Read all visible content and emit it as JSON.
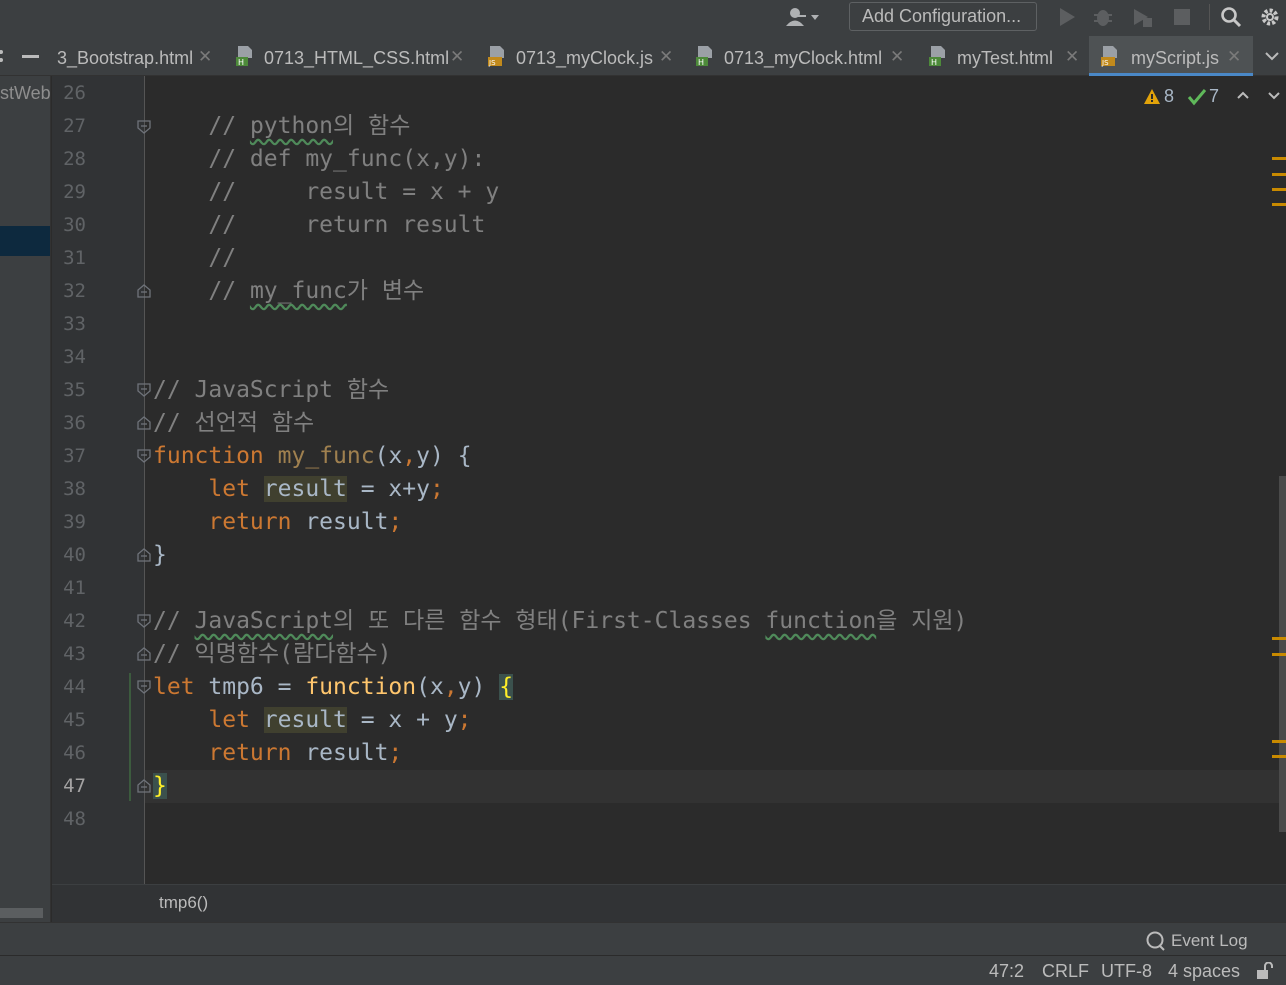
{
  "toolbar": {
    "run_configuration": "Add Configuration...",
    "icons": [
      "user-icon",
      "run-icon",
      "debug-icon",
      "coverage-icon",
      "stop-icon",
      "search-icon",
      "settings-icon"
    ]
  },
  "tabs": [
    {
      "label": "3_Bootstrap.html",
      "type": "html"
    },
    {
      "label": "0713_HTML_CSS.html",
      "type": "html"
    },
    {
      "label": "0713_myClock.js",
      "type": "js"
    },
    {
      "label": "0713_myClock.html",
      "type": "html"
    },
    {
      "label": "myTest.html",
      "type": "html"
    },
    {
      "label": "myScript.js",
      "type": "js",
      "active": true
    }
  ],
  "project_panel": {
    "label": "stWeb"
  },
  "inspections": {
    "warnings": "8",
    "weak_warnings": "7"
  },
  "editor": {
    "current_line": "47",
    "line_numbers": [
      "26",
      "27",
      "28",
      "29",
      "30",
      "31",
      "32",
      "33",
      "34",
      "35",
      "36",
      "37",
      "38",
      "39",
      "40",
      "41",
      "42",
      "43",
      "44",
      "45",
      "46",
      "47",
      "48"
    ],
    "lines": {
      "l27": {
        "a": "    // ",
        "b": "python",
        "c": "의 함수"
      },
      "l28": "    // def my_func(x,y):",
      "l29": "    //     result = x + y",
      "l30": "    //     return result",
      "l31": "    //",
      "l32": {
        "a": "    // ",
        "b": "my_func",
        "c": "가 변수"
      },
      "l35": "// JavaScript 함수",
      "l36": "// 선언적 함수",
      "l37": {
        "kw": "function",
        "name": "my_func",
        "params_open": "(",
        "p1": "x",
        "comma": ",",
        "p2": "y",
        "params_close": ")",
        "brace": " {"
      },
      "l38": {
        "indent": "    ",
        "kw": "let",
        "var": "result",
        "rest": " = x+y",
        "semi": ";"
      },
      "l39": {
        "indent": "    ",
        "kw": "return",
        "rest": " result",
        "semi": ";"
      },
      "l40": "}",
      "l42": {
        "a": "// ",
        "b": "JavaScript",
        "c": "의 또 다른 함수 형태(First-Classes ",
        "d": "function",
        "e": "을 지원)"
      },
      "l43": "// 익명함수(람다함수)",
      "l44": {
        "kw": "let",
        "var": " tmp6 = ",
        "fn": "function",
        "params": "(x",
        "comma": ",",
        "params2": "y) ",
        "brace": "{"
      },
      "l45": {
        "indent": "    ",
        "kw": "let",
        "sp": " ",
        "var": "result",
        "rest": " = x + y",
        "semi": ";"
      },
      "l46": {
        "indent": "    ",
        "kw": "return",
        "rest": " result",
        "semi": ";"
      },
      "l47": "}"
    }
  },
  "breadcrumb": "tmp6()",
  "event_log": "Event Log",
  "status": {
    "position": "47:2",
    "line_separator": "CRLF",
    "encoding": "UTF-8",
    "indent": "4 spaces"
  },
  "colors": {
    "keyword": "#cc7832",
    "function": "#ffc66d",
    "comment": "#808080",
    "text": "#a9b7c6",
    "background": "#2b2b2b",
    "warning": "#e2a30a",
    "ok": "#5fb85a"
  }
}
